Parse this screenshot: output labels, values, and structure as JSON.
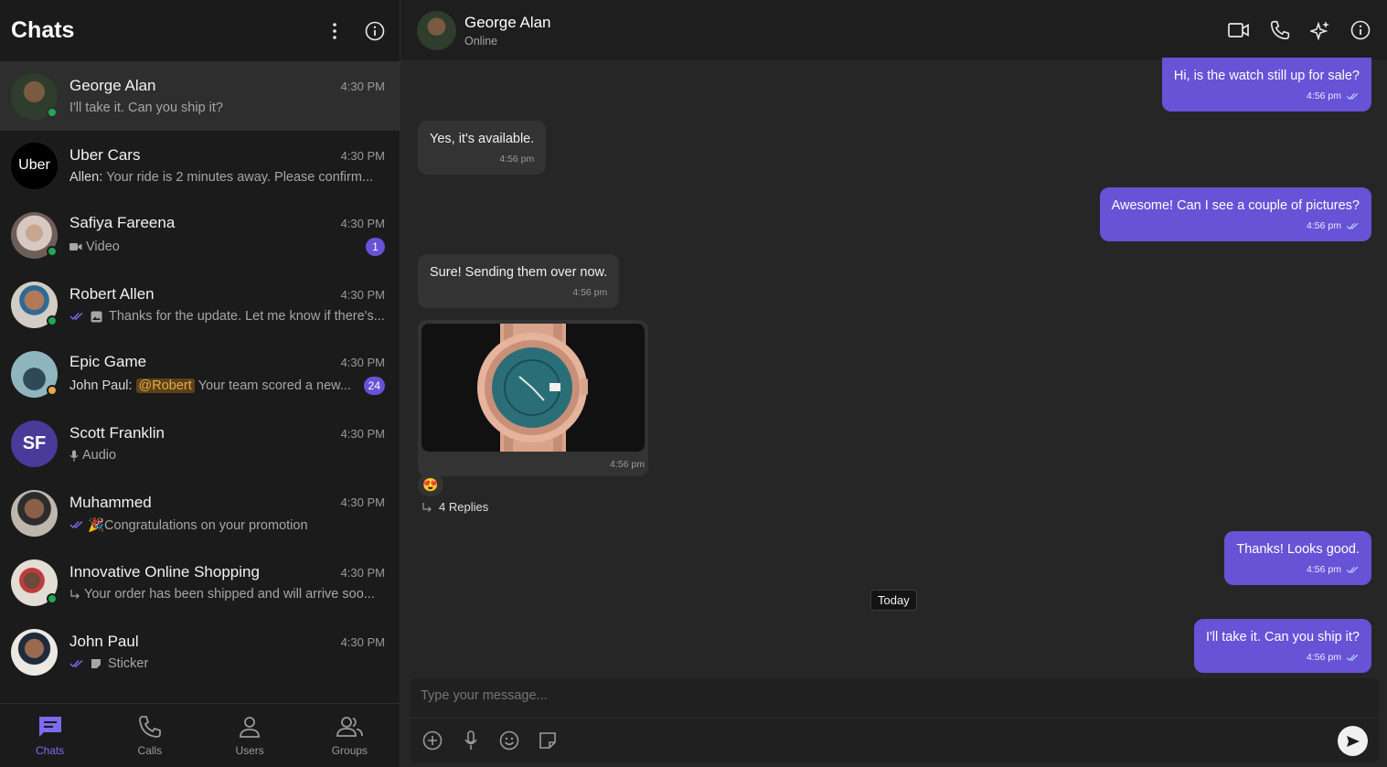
{
  "sidebar": {
    "title": "Chats",
    "chats": [
      {
        "name": "George Alan",
        "time": "4:30 PM",
        "preview": "I'll take it. Can you ship it?",
        "avatar_color": "#3b4a3a",
        "online": true
      },
      {
        "name": "Uber Cars",
        "time": "4:30 PM",
        "sender": "Allen:",
        "preview": "Your ride is 2 minutes away. Please confirm...",
        "avatar_text": "Uber",
        "avatar_color": "#000000"
      },
      {
        "name": "Safiya Fareena",
        "time": "4:30 PM",
        "preview": "Video",
        "badge": "1",
        "avatar_color": "#8a7a70",
        "online": true
      },
      {
        "name": "Robert Allen",
        "time": "4:30 PM",
        "preview": "Thanks for the update. Let me know if there's...",
        "avatar_color": "#c7c2b8",
        "online": true
      },
      {
        "name": "Epic Game",
        "time": "4:30 PM",
        "sender": "John Paul:",
        "mention": "@Robert",
        "preview": "Your team scored a new...",
        "badge": "24",
        "avatar_color": "#4d6f7a"
      },
      {
        "name": "Scott Franklin",
        "time": "4:30 PM",
        "preview": "Audio",
        "avatar_text": "SF",
        "avatar_color": "#4a3a9a"
      },
      {
        "name": "Muhammed",
        "time": "4:30 PM",
        "preview": "🎉Congratulations on your promotion",
        "avatar_color": "#b8b2aa"
      },
      {
        "name": "Innovative Online Shopping",
        "time": "4:30 PM",
        "preview": "Your order has been shipped and will arrive soo...",
        "avatar_color": "#d8d2c8"
      },
      {
        "name": "John Paul",
        "time": "4:30 PM",
        "preview": "Sticker",
        "avatar_color": "#e0dad2"
      }
    ]
  },
  "nav": [
    {
      "label": "Chats",
      "icon": "chat-icon"
    },
    {
      "label": "Calls",
      "icon": "phone-icon"
    },
    {
      "label": "Users",
      "icon": "user-icon"
    },
    {
      "label": "Groups",
      "icon": "group-icon"
    }
  ],
  "conversation": {
    "name": "George Alan",
    "status": "Online",
    "messages": [
      {
        "text": "Hi, is the watch still up for sale?",
        "time": "4:56 pm",
        "dir": "out"
      },
      {
        "text": "Yes, it's available.",
        "time": "4:56 pm",
        "dir": "in"
      },
      {
        "text": "Awesome! Can I see a couple of pictures?",
        "time": "4:56 pm",
        "dir": "out"
      },
      {
        "text": "Sure! Sending them over now.",
        "time": "4:56 pm",
        "dir": "in"
      },
      {
        "image_time": "4:56 pm",
        "reaction": "😍",
        "replies": "4 Replies"
      },
      {
        "text": "Thanks! Looks good.",
        "time": "4:56 pm",
        "dir": "out"
      },
      {
        "text": "I'll take it. Can you ship it?",
        "time": "4:56 pm",
        "dir": "out"
      }
    ],
    "date_divider": "Today"
  },
  "composer": {
    "placeholder": "Type your message..."
  },
  "colors": {
    "accent": "#6852d6",
    "online": "#1fa855"
  }
}
